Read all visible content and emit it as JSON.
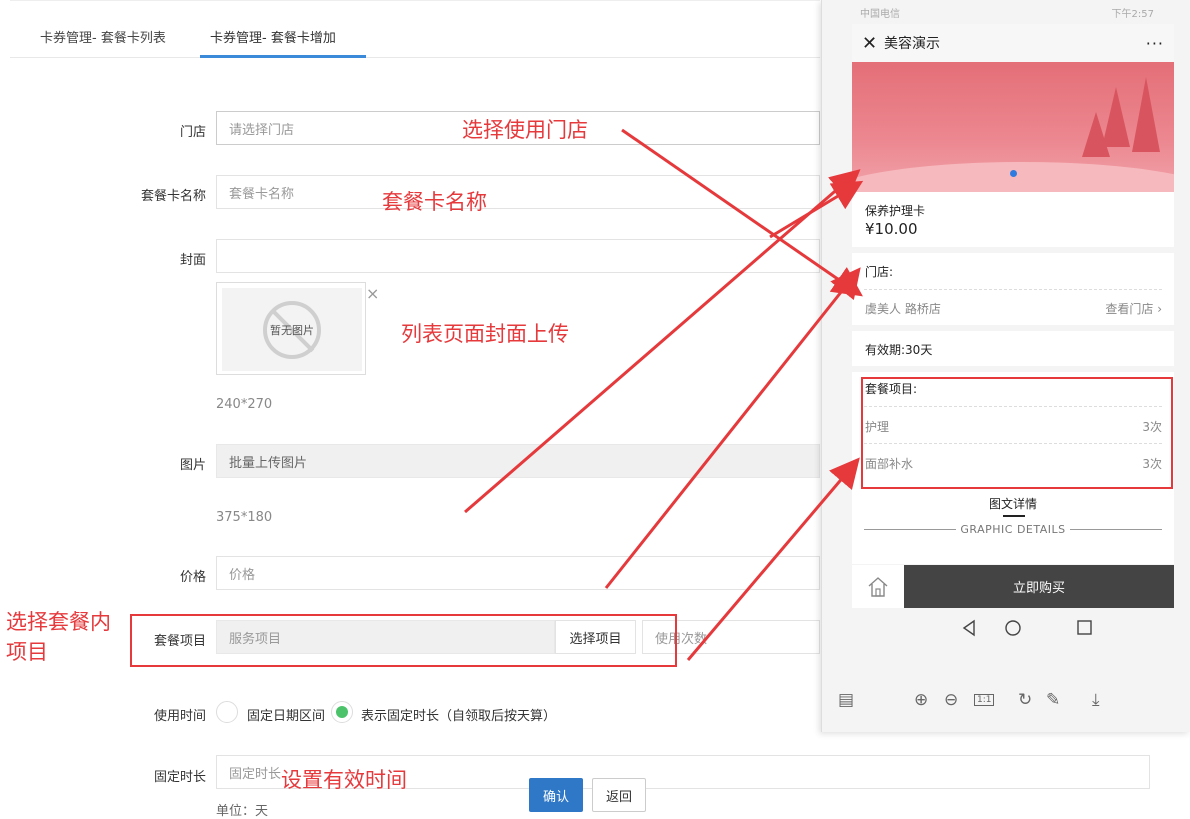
{
  "tabs": [
    {
      "label": "卡券管理- 套餐卡列表"
    },
    {
      "label": "卡券管理- 套餐卡增加"
    }
  ],
  "form": {
    "store_label": "门店",
    "store_placeholder": "请选择门店",
    "name_label": "套餐卡名称",
    "name_placeholder": "套餐卡名称",
    "cover_label": "封面",
    "no_image_text": "暂无图片",
    "close_mark": "×",
    "cover_size": "240*270",
    "pictures_label": "图片",
    "pictures_button": "批量上传图片",
    "pictures_size": "375*180",
    "price_label": "价格",
    "price_placeholder": "价格",
    "items_label": "套餐项目",
    "items_placeholder": "服务项目",
    "items_select_button": "选择项目",
    "items_count_placeholder": "使用次数",
    "use_time_label": "使用时间",
    "use_time_opt1": "固定日期区间",
    "use_time_opt2": "表示固定时长（自领取后按天算）",
    "duration_label": "固定时长",
    "duration_placeholder": "固定时长",
    "duration_unit": "单位：天",
    "confirm_button": "确认",
    "back_button": "返回"
  },
  "annotations": {
    "store": "选择使用门店",
    "name": "套餐卡名称",
    "cover": "列表页面封面上传",
    "items_line1": "选择套餐内",
    "items_line2": "项目",
    "duration": "设置有效时间"
  },
  "phone": {
    "carrier": "中国电信",
    "time": "下午2:57",
    "title": "美容演示",
    "more": "···",
    "card_name": "保养护理卡",
    "card_price": "¥10.00",
    "store_label": "门店:",
    "store_name": "虞美人 路桥店",
    "view_store": "查看门店 ›",
    "validity": "有效期:30天",
    "package_label": "套餐项目:",
    "package_items": [
      {
        "name": "护理",
        "count": "3次"
      },
      {
        "name": "面部补水",
        "count": "3次"
      }
    ],
    "detail_title": "图文详情",
    "detail_en": "GRAPHIC DETAILS",
    "buy_button": "立即购买",
    "zoom_fit": "1:1"
  },
  "colors": {
    "annotation_red": "#e5393c",
    "tab_accent": "#3b8ad9",
    "confirm_blue": "#2f78c8",
    "radio_green": "#4cc36a",
    "buy_dark": "#444444",
    "banner_pink": "#e46f78"
  }
}
